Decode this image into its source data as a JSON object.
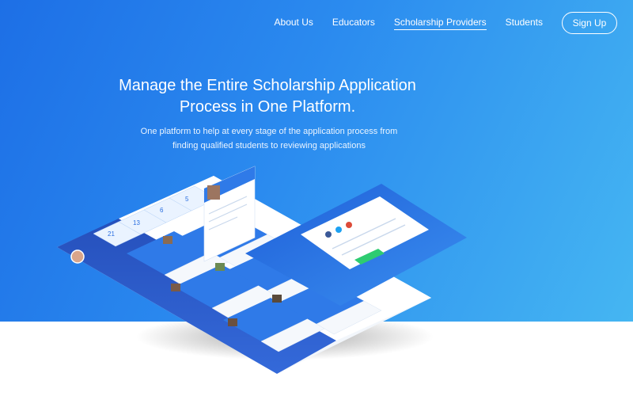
{
  "nav": {
    "links": [
      "About Us",
      "Educators",
      "Scholarship Providers",
      "Students"
    ],
    "active_index": 2,
    "signup_label": "Sign Up"
  },
  "hero": {
    "headline_line1": "Manage the Entire Scholarship Application",
    "headline_line2": "Process in One Platform.",
    "subtext_line1": "One platform to help at every stage of the application process from",
    "subtext_line2": "finding qualified students to reviewing applications"
  },
  "colors": {
    "gradient_start": "#1d6fe6",
    "gradient_end": "#45b6f2",
    "accent_green": "#2ecc71",
    "panel_blue": "#2a6ee0"
  },
  "mockup": {
    "stat_values": [
      "21",
      "13",
      "6",
      "5"
    ],
    "icon_names": [
      "avatar-icon",
      "profile-card-icon",
      "login-form-icon"
    ]
  }
}
